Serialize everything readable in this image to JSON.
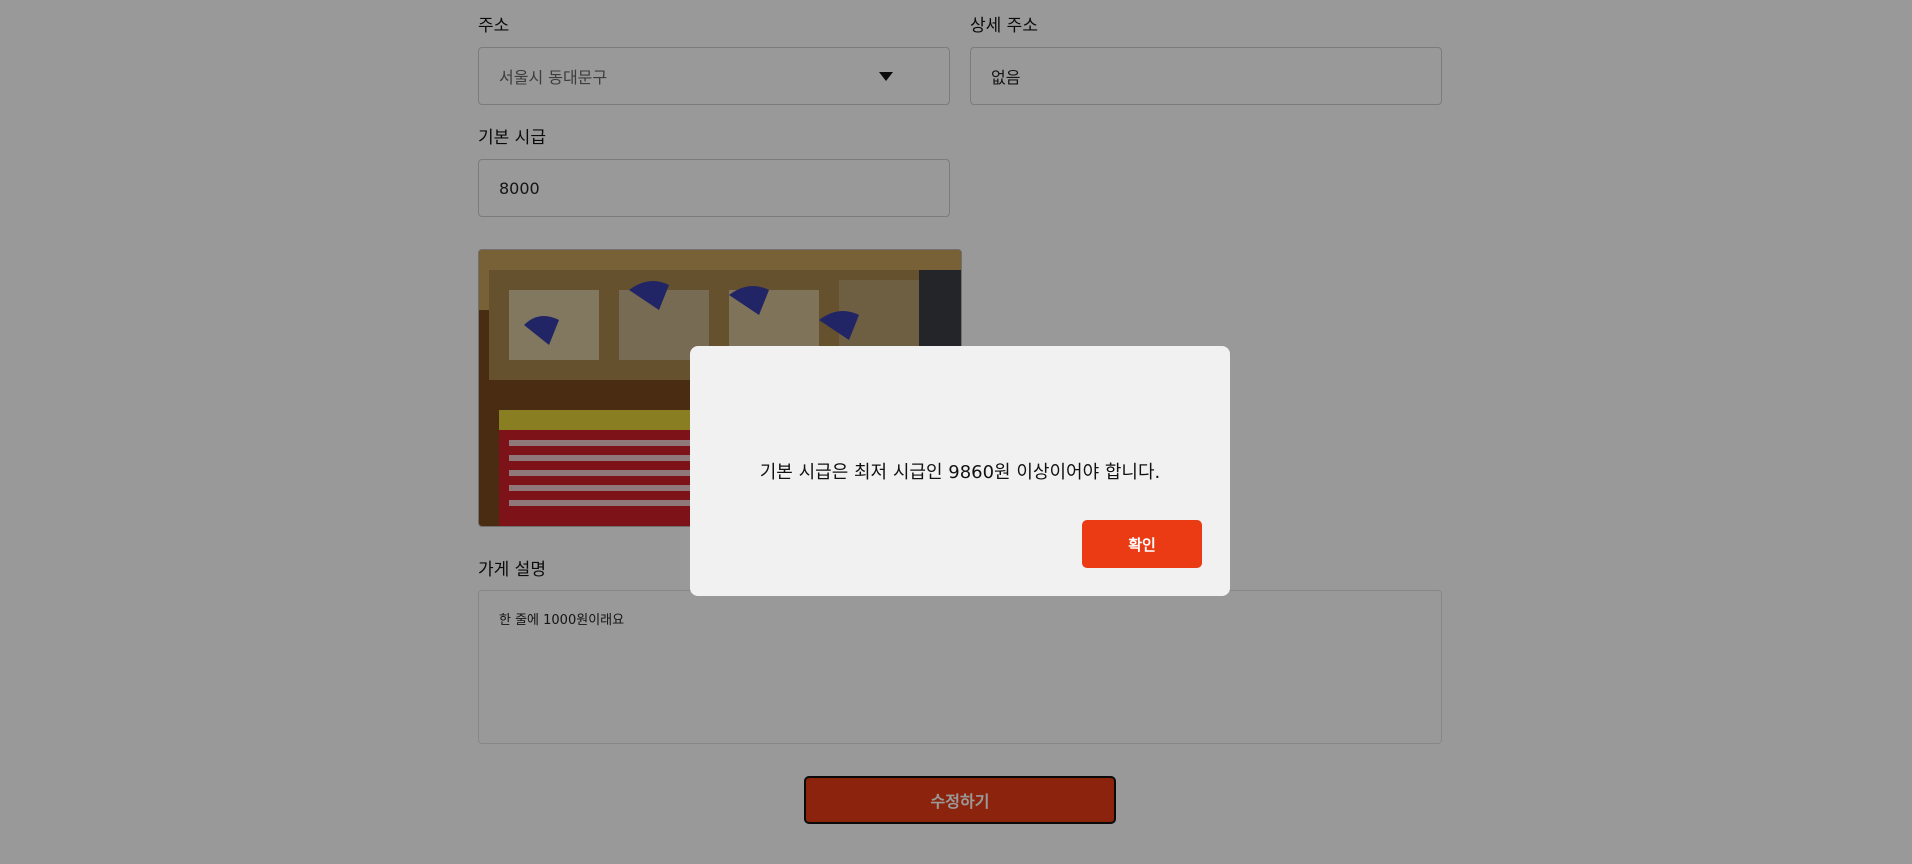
{
  "form": {
    "address_label": "주소",
    "address_value": "서울시 동대문구",
    "detail_address_label": "상세 주소",
    "detail_address_value": "없음",
    "wage_label": "기본 시급",
    "wage_value": "8000",
    "store_photo_icon": "store-photo",
    "description_label": "가게 설명",
    "description_value": "한 줄에 1000원이래요",
    "submit_label": "수정하기"
  },
  "modal": {
    "message": "기본 시급은 최저 시급인 9860원 이상이어야 합니다.",
    "confirm_label": "확인"
  },
  "colors": {
    "accent": "#ea3b14",
    "overlay": "rgba(0,0,0,0.40)",
    "modal_bg": "#f1f1f1"
  }
}
